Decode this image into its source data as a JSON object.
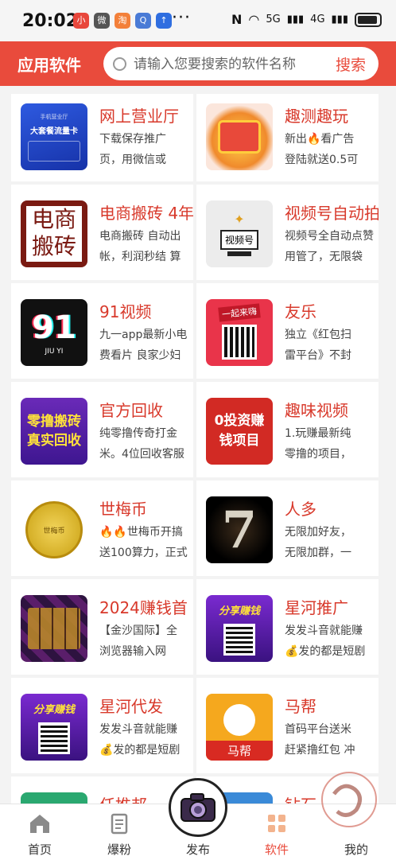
{
  "status_bar": {
    "time": "20:02",
    "network": "5G",
    "network2": "4G",
    "app_icons": [
      "小",
      "微",
      "淘",
      "Q",
      "↑"
    ]
  },
  "header": {
    "title": "应用软件",
    "search_placeholder": "请输入您要搜索的软件名称",
    "search_button": "搜索"
  },
  "apps": [
    {
      "title": "网上营业厅",
      "desc1": "下载保存推广",
      "desc2": "页，用微信或",
      "thumb_text": "大套餐流量卡",
      "thumb_sub": "手机营业厅"
    },
    {
      "title": "趣测趣玩",
      "desc1": "新出🔥看广告",
      "desc2": "登陆就送0.5可",
      "thumb_text": ""
    },
    {
      "title": "电商搬砖 4年",
      "desc1": "电商搬砖 自动出",
      "desc2": "帐，利润秒结 算",
      "thumb_text": "电商搬砖"
    },
    {
      "title": "视频号自动拍",
      "desc1": "视频号全自动点赞",
      "desc2": "用管了，无限袋",
      "thumb_text": "视频号"
    },
    {
      "title": "91视频",
      "desc1": "九一app最新小电",
      "desc2": "费看片 良家少妇",
      "thumb_text": "91",
      "thumb_sub": "JIU YI"
    },
    {
      "title": "友乐",
      "desc1": "独立《红包扫",
      "desc2": "雷平台》不封",
      "thumb_text": "一起来嗨"
    },
    {
      "title": "官方回收",
      "desc1": "纯零撸传奇打金",
      "desc2": "米。4位回收客服",
      "thumb_text": "零撸搬砖真实回收"
    },
    {
      "title": "趣味视频",
      "desc1": "1.玩赚最新纯",
      "desc2": "零撸的项目，",
      "thumb_text": "0投资赚钱项目"
    },
    {
      "title": "世梅币",
      "desc1": "🔥🔥世梅币开搞",
      "desc2": "送100算力，正式",
      "thumb_text": "世梅币"
    },
    {
      "title": "人多",
      "desc1": "无限加好友，",
      "desc2": "无限加群，一",
      "thumb_text": "7"
    },
    {
      "title": "2024赚钱首",
      "desc1": "【金沙国际】全",
      "desc2": "浏览器输入网",
      "thumb_text": ""
    },
    {
      "title": "星河推广",
      "desc1": "发发斗音就能赚",
      "desc2": "💰发的都是短剧",
      "thumb_text": "分享赚钱"
    },
    {
      "title": "星河代发",
      "desc1": "发发斗音就能赚",
      "desc2": "💰发的都是短剧",
      "thumb_text": "分享赚钱"
    },
    {
      "title": "马帮",
      "desc1": "首码平台送米",
      "desc2": "赶紧撸红包 冲",
      "thumb_text": "马帮"
    },
    {
      "title": "任推邦",
      "desc1": "",
      "desc2": "",
      "thumb_text": ""
    },
    {
      "title": "钻石",
      "desc1": "",
      "desc2": "",
      "thumb_text": ""
    }
  ],
  "nav": [
    {
      "label": "首页",
      "icon": "home-icon"
    },
    {
      "label": "爆粉",
      "icon": "document-icon"
    },
    {
      "label": "发布",
      "icon": "camera-icon"
    },
    {
      "label": "软件",
      "icon": "apps-icon"
    },
    {
      "label": "我的",
      "icon": "user-icon"
    }
  ],
  "colors": {
    "brand": "#e94b3c",
    "title": "#d8392b"
  }
}
